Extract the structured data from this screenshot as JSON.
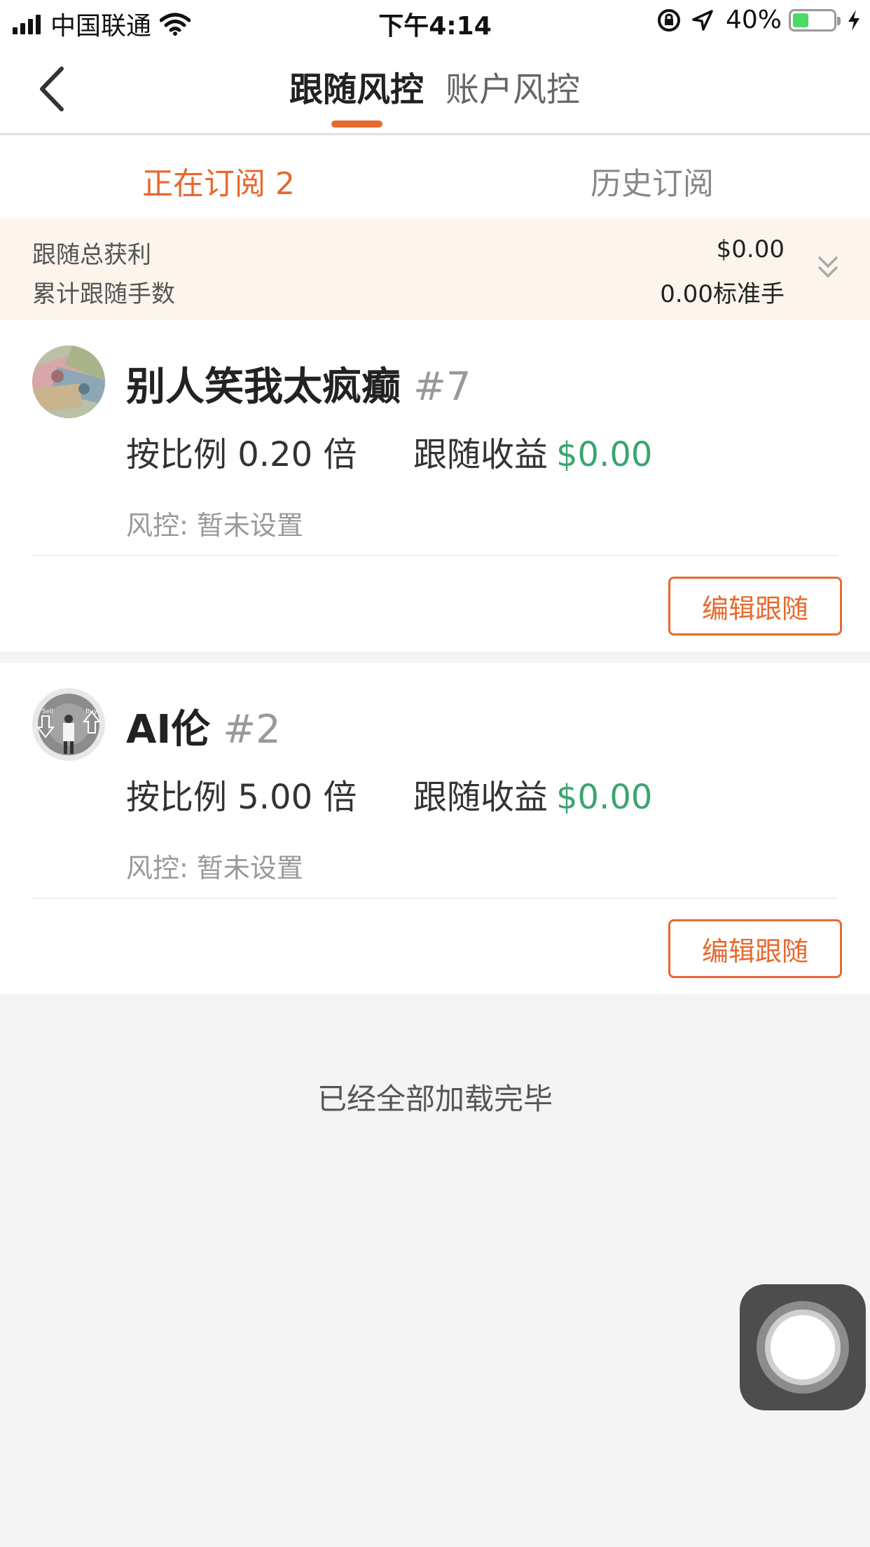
{
  "status_bar": {
    "carrier": "中国联通",
    "time": "下午4:14",
    "battery": "40%",
    "battery_level": 0.4
  },
  "nav": {
    "tabs": [
      "跟随风控",
      "账户风控"
    ],
    "active_tab": 0
  },
  "sub_tabs": {
    "current": "正在订阅 2",
    "history": "历史订阅"
  },
  "summary": {
    "total_profit_label": "跟随总获利",
    "total_profit_value": "$0.00",
    "lots_label": "累计跟随手数",
    "lots_value": "0.00标准手"
  },
  "subscriptions": [
    {
      "name": "别人笑我太疯癫",
      "tag": "#7",
      "ratio": "按比例 0.20 倍",
      "profit_label": "跟随收益",
      "profit_value": "$0.00",
      "risk": "风控: 暂未设置",
      "edit_label": "编辑跟随"
    },
    {
      "name": "AI伦",
      "tag": "#2",
      "ratio": "按比例 5.00 倍",
      "profit_label": "跟随收益",
      "profit_value": "$0.00",
      "risk": "风控: 暂未设置",
      "edit_label": "编辑跟随",
      "avatar_text": [
        "Sell",
        "Buy"
      ]
    }
  ],
  "footer": {
    "loaded_all": "已经全部加载完毕"
  },
  "icons": {
    "back": "chevron-left-icon",
    "expand": "double-chevron-down-icon",
    "assistive": "assistive-touch-icon"
  },
  "colors": {
    "accent": "#e8692e",
    "profit": "#3aa56f",
    "summary_bg": "#fdf4ec"
  }
}
